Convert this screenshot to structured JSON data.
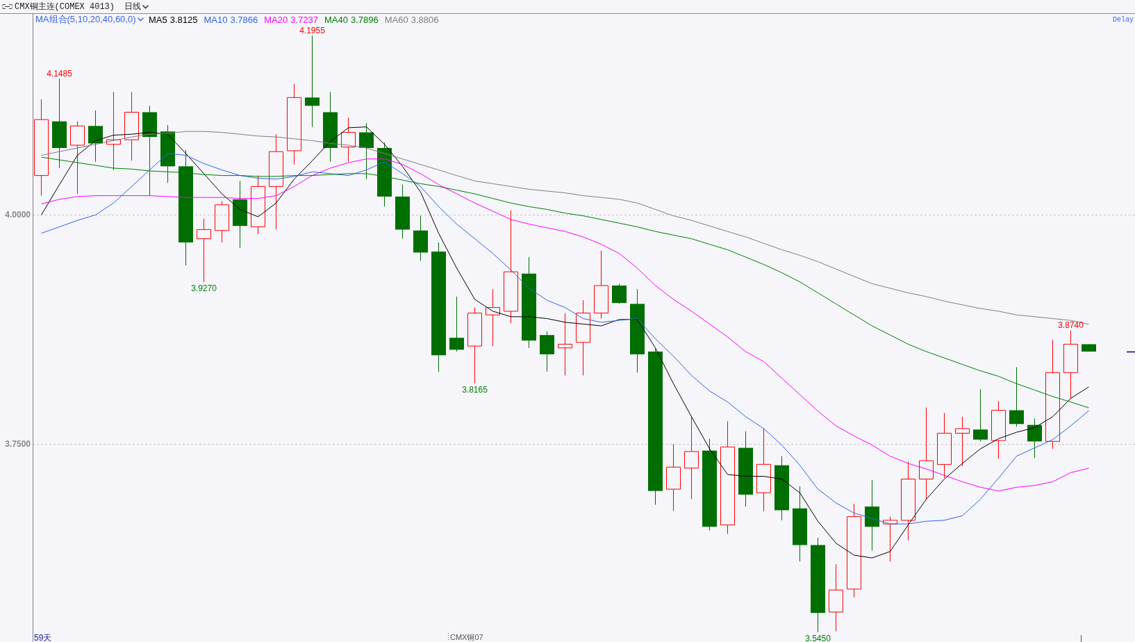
{
  "toolbar": {
    "symbol": "CMX铜主连(COMEX 4013)",
    "period": "日线"
  },
  "legend": {
    "group": "MA组合(5,10,20,40,60,0)",
    "values": [
      "3.8125",
      "3.7866",
      "3.7237",
      "3.7896",
      "3.8806"
    ]
  },
  "delay": "Delay",
  "chart": {
    "chart_data": {
      "type": "line",
      "ylim": [
        3.5343,
        4.2192
      ],
      "yticks": [
        {
          "value": 4.0,
          "label": "4.0000"
        },
        {
          "value": 3.75,
          "label": "3.7500"
        }
      ],
      "series": [
        {
          "name": "MA5",
          "color": "#000000",
          "values": [
            4.0,
            4.033,
            4.065,
            4.081,
            4.087,
            4.088,
            4.09,
            4.088,
            4.067,
            4.045,
            4.023,
            4.006,
            3.998,
            4.013,
            4.039,
            4.059,
            4.08,
            4.095,
            4.096,
            4.077,
            4.053,
            4.025,
            3.98,
            3.942,
            3.908,
            3.895,
            3.889,
            3.889,
            3.887,
            3.883,
            3.881,
            3.879,
            3.886,
            3.886,
            3.855,
            3.816,
            3.78,
            3.745,
            3.717,
            3.715,
            3.715,
            3.712,
            3.697,
            3.666,
            3.642,
            3.629,
            3.626,
            3.633,
            3.662,
            3.69,
            3.712,
            3.729,
            3.745,
            3.756,
            3.763,
            3.768,
            3.78,
            3.8,
            3.8125
          ]
        },
        {
          "name": "MA10",
          "color": "#3264e6",
          "values": [
            3.98,
            3.987,
            3.994,
            4.0,
            4.013,
            4.031,
            4.049,
            4.067,
            4.065,
            4.056,
            4.049,
            4.043,
            4.04,
            4.039,
            4.042,
            4.047,
            4.045,
            4.043,
            4.049,
            4.058,
            4.045,
            4.031,
            4.009,
            3.99,
            3.974,
            3.958,
            3.94,
            3.92,
            3.907,
            3.899,
            3.887,
            3.883,
            3.885,
            3.887,
            3.865,
            3.846,
            3.825,
            3.808,
            3.796,
            3.78,
            3.767,
            3.749,
            3.727,
            3.701,
            3.686,
            3.675,
            3.669,
            3.663,
            3.663,
            3.666,
            3.667,
            3.672,
            3.69,
            3.713,
            3.737,
            3.746,
            3.755,
            3.77,
            3.7866
          ]
        },
        {
          "name": "MA20",
          "color": "#ff00ff",
          "values": [
            4.012,
            4.017,
            4.02,
            4.021,
            4.021,
            4.021,
            4.021,
            4.02,
            4.019,
            4.019,
            4.019,
            4.018,
            4.018,
            4.021,
            4.031,
            4.043,
            4.051,
            4.057,
            4.061,
            4.061,
            4.055,
            4.045,
            4.033,
            4.023,
            4.013,
            4.004,
            3.995,
            3.99,
            3.986,
            3.982,
            3.976,
            3.968,
            3.958,
            3.942,
            3.923,
            3.908,
            3.895,
            3.881,
            3.867,
            3.851,
            3.84,
            3.822,
            3.804,
            3.786,
            3.77,
            3.759,
            3.749,
            3.737,
            3.729,
            3.723,
            3.716,
            3.709,
            3.703,
            3.699,
            3.703,
            3.705,
            3.709,
            3.719,
            3.7237
          ]
        },
        {
          "name": "MA40",
          "color": "#008000",
          "values": [
            4.063,
            4.06,
            4.057,
            4.054,
            4.051,
            4.05,
            4.048,
            4.047,
            4.046,
            4.044,
            4.043,
            4.043,
            4.042,
            4.042,
            4.043,
            4.043,
            4.044,
            4.045,
            4.045,
            4.042,
            4.038,
            4.034,
            4.031,
            4.027,
            4.023,
            4.018,
            4.013,
            4.009,
            4.006,
            4.002,
            3.999,
            3.995,
            3.991,
            3.987,
            3.982,
            3.978,
            3.974,
            3.968,
            3.962,
            3.954,
            3.946,
            3.937,
            3.927,
            3.915,
            3.903,
            3.891,
            3.879,
            3.869,
            3.859,
            3.851,
            3.844,
            3.837,
            3.83,
            3.824,
            3.816,
            3.809,
            3.802,
            3.796,
            3.7896
          ]
        },
        {
          "name": "MA60",
          "color": "#808080",
          "values": [
            4.065,
            4.069,
            4.073,
            4.077,
            4.081,
            4.085,
            4.088,
            4.089,
            4.091,
            4.091,
            4.09,
            4.088,
            4.086,
            4.085,
            4.083,
            4.081,
            4.078,
            4.076,
            4.073,
            4.067,
            4.061,
            4.055,
            4.049,
            4.043,
            4.037,
            4.034,
            4.031,
            4.028,
            4.026,
            4.024,
            4.021,
            4.019,
            4.017,
            4.013,
            4.006,
            3.999,
            3.994,
            3.988,
            3.982,
            3.976,
            3.969,
            3.962,
            3.956,
            3.949,
            3.941,
            3.933,
            3.925,
            3.92,
            3.915,
            3.911,
            3.906,
            3.902,
            3.898,
            3.895,
            3.891,
            3.889,
            3.887,
            3.885,
            3.8806
          ]
        }
      ],
      "annotations": [
        "4.1485",
        "3.9270",
        "4.1955",
        "3.8165",
        "3.5450",
        "3.8740"
      ]
    },
    "day_count": "59天",
    "contract": "CMX铜07"
  }
}
